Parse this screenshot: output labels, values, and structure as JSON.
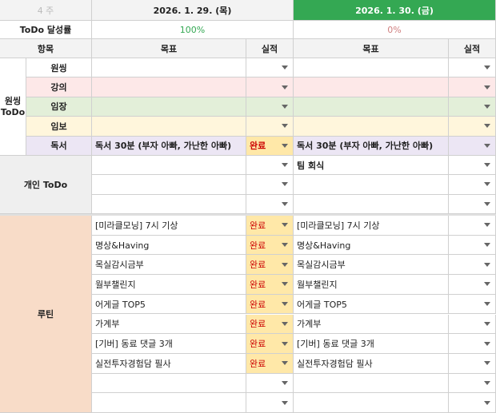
{
  "week_label": "4 주",
  "dates": [
    "2026. 1. 29. (목)",
    "2026. 1. 30. (금)"
  ],
  "todo_rate_label": "ToDo 달성률",
  "todo_rates": [
    "100%",
    "0%"
  ],
  "item_header": "항목",
  "goal_header": "목표",
  "result_header": "실적",
  "wonsing_group_label": "원씽\nToDo",
  "wonsing_rows": [
    {
      "label": "원씽",
      "goal1": "",
      "result1": "",
      "goal2": "",
      "result2": ""
    },
    {
      "label": "강의",
      "goal1": "",
      "result1": "",
      "goal2": "",
      "result2": ""
    },
    {
      "label": "임장",
      "goal1": "",
      "result1": "",
      "goal2": "",
      "result2": ""
    },
    {
      "label": "임보",
      "goal1": "",
      "result1": "",
      "goal2": "",
      "result2": ""
    },
    {
      "label": "독서",
      "goal1": "독서 30분 (부자 아빠, 가난한 아빠)",
      "result1": "완료",
      "goal2": "독서 30분 (부자 아빠, 가난한 아빠)",
      "result2": ""
    }
  ],
  "personal_label": "개인 ToDo",
  "personal_rows": [
    {
      "goal1": "",
      "result1": "",
      "goal2": "팀 회식",
      "result2": ""
    },
    {
      "goal1": "",
      "result1": "",
      "goal2": "",
      "result2": ""
    },
    {
      "goal1": "",
      "result1": "",
      "goal2": "",
      "result2": ""
    }
  ],
  "routine_label": "루틴",
  "routine_rows": [
    {
      "goal1": "[미라클모닝] 7시 기상",
      "result1": "완료",
      "goal2": "[미라클모닝] 7시 기상",
      "result2": ""
    },
    {
      "goal1": "명상&Having",
      "result1": "완료",
      "goal2": "명상&Having",
      "result2": ""
    },
    {
      "goal1": "목실감시금부",
      "result1": "완료",
      "goal2": "목실감시금부",
      "result2": ""
    },
    {
      "goal1": "월부챌린지",
      "result1": "완료",
      "goal2": "월부챌린지",
      "result2": ""
    },
    {
      "goal1": "어게글 TOP5",
      "result1": "완료",
      "goal2": "어게글 TOP5",
      "result2": ""
    },
    {
      "goal1": "가계부",
      "result1": "완료",
      "goal2": "가계부",
      "result2": ""
    },
    {
      "goal1": "[기버] 동료 댓글 3개",
      "result1": "완료",
      "goal2": "[기버] 동료 댓글 3개",
      "result2": ""
    },
    {
      "goal1": "실전투자경험담 필사",
      "result1": "완료",
      "goal2": "실전투자경험담 필사",
      "result2": ""
    },
    {
      "goal1": "",
      "result1": "",
      "goal2": "",
      "result2": ""
    },
    {
      "goal1": "",
      "result1": "",
      "goal2": "",
      "result2": ""
    }
  ],
  "colors": {
    "date2_header_bg": "#34a853",
    "wonsing_bg": "#ffffff",
    "lecture_bg": "#fde8e8",
    "imjang_bg": "#e3efd9",
    "imbo_bg": "#fff6dc",
    "reading_bg": "#ece6f4",
    "personal_label_bg": "#efefef",
    "routine_label_bg": "#f8dcc8",
    "done_cell_bg": "#ffe8a8"
  }
}
